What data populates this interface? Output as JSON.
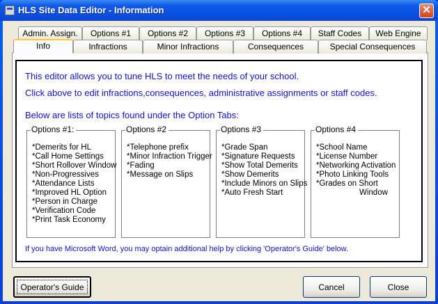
{
  "window": {
    "title": "HLS Site Data Editor - Information",
    "close_glyph": "✕"
  },
  "tabs_row1": [
    "Admin. Assign.",
    "Options #1",
    "Options #2",
    "Options #3",
    "Options #4",
    "Staff Codes",
    "Web Engine"
  ],
  "tabs_row2": [
    "Info",
    "Infractions",
    "Minor Infractions",
    "Consequences",
    "Special Consequences"
  ],
  "active_tab": "Info",
  "intro": {
    "line1": "This editor allows you to tune HLS to meet the needs of your school.",
    "line2": "Click above to edit infractions,consequences, administrative assignments or staff codes.",
    "line3": "Below are lists of topics found under the Option Tabs:"
  },
  "groups": [
    {
      "title": "Options #1:",
      "items": [
        "*Demerits for HL",
        "*Call Home Settings",
        "*Short Rollover Window",
        "*Non-Progressives",
        "*Attendance Lists",
        "*Improved HL Option",
        "*Person in Charge",
        "*Verification Code",
        "*Print Task Economy"
      ]
    },
    {
      "title": "Options #2",
      "items": [
        "*Telephone prefix",
        "*Minor Infraction Trigger",
        "*Fading",
        "*Message on Slips"
      ]
    },
    {
      "title": "Options #3",
      "items": [
        "*Grade Span",
        "*Signature Requests",
        "*Show Total Demerits",
        "*Show Demerits",
        "*Include Minors on Slips",
        "*Auto Fresh Start"
      ]
    },
    {
      "title": "Options #4",
      "items": [
        "*School Name",
        "*License Number",
        "*Networking Activation",
        "*Photo Linking Tools",
        "*Grades on Short",
        "Window"
      ]
    }
  ],
  "footer_note": "If you have Microsoft Word, you may optain additional help by clicking 'Operator's Guide' below.",
  "buttons": {
    "operators_guide": "Operator's Guide",
    "cancel": "Cancel",
    "close": "Close"
  },
  "colors": {
    "titlebar": "#0b4fe0",
    "info_text": "#1010c8",
    "tab_highlight": "#ffc83c",
    "dialog_bg": "#ece9d8"
  }
}
